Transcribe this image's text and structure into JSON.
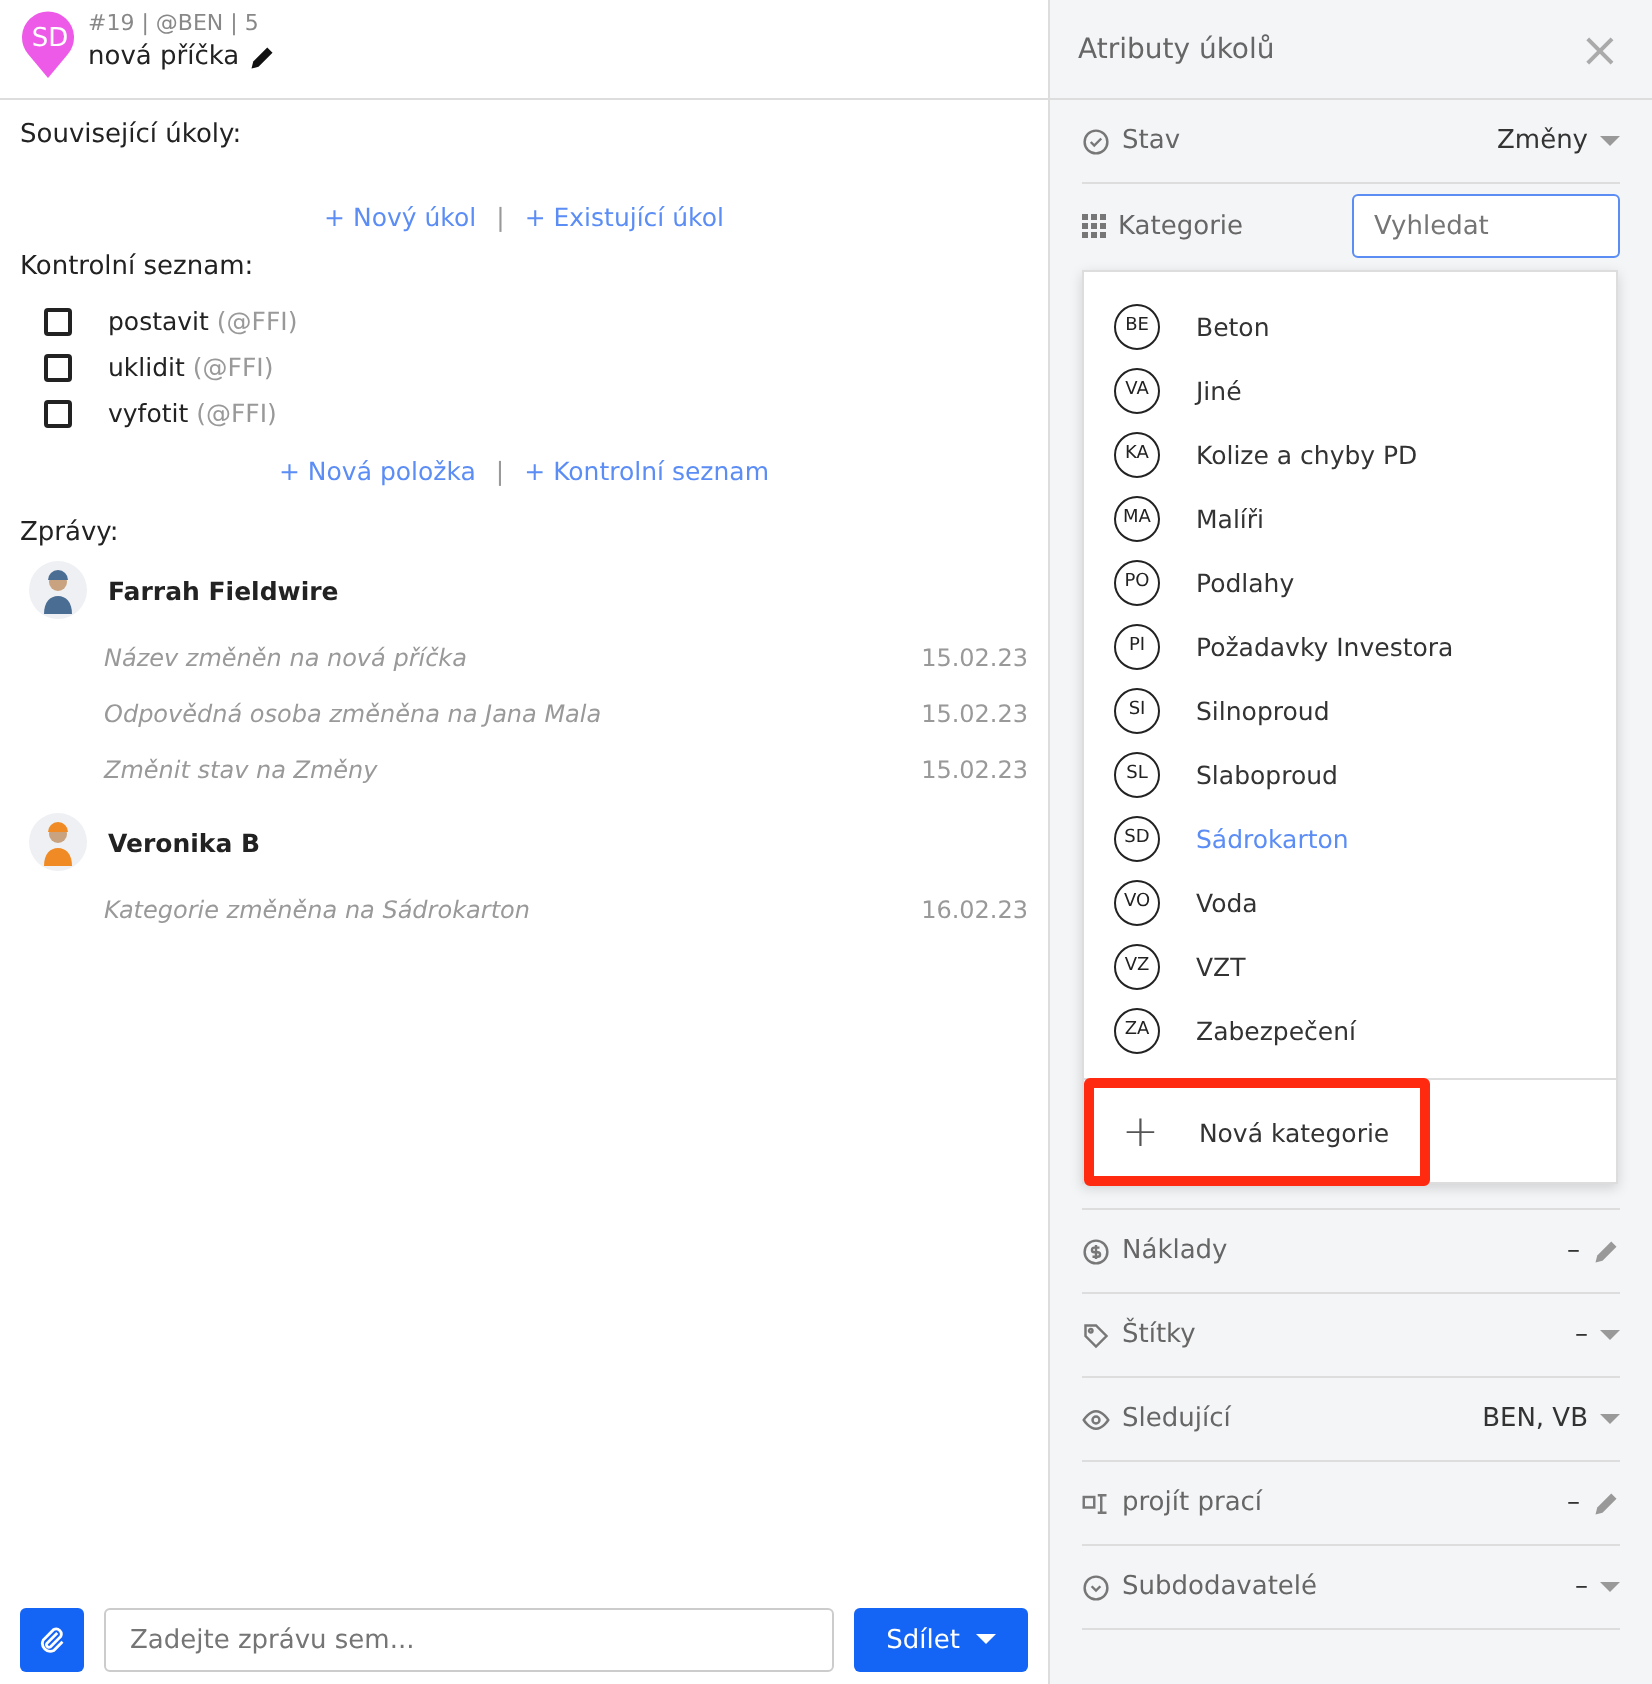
{
  "task": {
    "avatar": "SD",
    "meta": "#19 | @BEN | 5",
    "title": "nová příčka"
  },
  "related": {
    "heading": "Související úkoly:",
    "links": [
      "+ Nový úkol",
      "+ Existující úkol"
    ],
    "separator": "|"
  },
  "checklist": {
    "heading": "Kontrolní seznam:",
    "items": [
      {
        "label": "postavit",
        "assignee": "(@FFI)",
        "checked": false
      },
      {
        "label": "uklidit",
        "assignee": "(@FFI)",
        "checked": false
      },
      {
        "label": "vyfotit",
        "assignee": "(@FFI)",
        "checked": false
      }
    ],
    "links": [
      "+ Nová položka",
      "+ Kontrolní seznam"
    ],
    "separator": "|"
  },
  "messages": {
    "heading": "Zprávy:",
    "groups": [
      {
        "author": "Farrah Fieldwire",
        "entries": [
          {
            "text": "Název změněn na nová příčka",
            "date": "15.02.23"
          },
          {
            "text": "Odpovědná osoba změněna na Jana Mala",
            "date": "15.02.23"
          },
          {
            "text": "Změnit stav na Změny",
            "date": "15.02.23"
          }
        ]
      },
      {
        "author": "Veronika B",
        "entries": [
          {
            "text": "Kategorie změněna na Sádrokarton",
            "date": "16.02.23"
          }
        ]
      }
    ]
  },
  "composer": {
    "placeholder": "Zadejte zprávu sem...",
    "send": "Sdílet"
  },
  "panel": {
    "title": "Atributy úkolů",
    "close": "×",
    "top_rows": [
      {
        "label": "Stav",
        "value": "Změny",
        "kind": "dropdown"
      }
    ],
    "category": {
      "label": "Kategorie",
      "placeholder": "Vyhledat"
    },
    "rows": [
      {
        "label": "Náklady",
        "value": "–",
        "kind": "edit"
      },
      {
        "label": "Štítky",
        "value": "–",
        "kind": "dropdown"
      },
      {
        "label": "Sledující",
        "value": "BEN, VB",
        "kind": "dropdown"
      },
      {
        "label": "projít prací",
        "value": "–",
        "kind": "edit"
      },
      {
        "label": "Subdodavatelé",
        "value": "–",
        "kind": "dropdown"
      }
    ]
  },
  "category_menu": {
    "items": [
      {
        "code": "BE",
        "name": "Beton",
        "selected": false
      },
      {
        "code": "VA",
        "name": "Jiné",
        "selected": false
      },
      {
        "code": "KA",
        "name": "Kolize a chyby PD",
        "selected": false
      },
      {
        "code": "MA",
        "name": "Malíři",
        "selected": false
      },
      {
        "code": "PO",
        "name": "Podlahy",
        "selected": false
      },
      {
        "code": "PI",
        "name": "Požadavky Investora",
        "selected": false
      },
      {
        "code": "SI",
        "name": "Silnoproud",
        "selected": false
      },
      {
        "code": "SL",
        "name": "Slaboproud",
        "selected": false
      },
      {
        "code": "SD",
        "name": "Sádrokarton",
        "selected": true
      },
      {
        "code": "VO",
        "name": "Voda",
        "selected": false
      },
      {
        "code": "VZ",
        "name": "VZT",
        "selected": false
      },
      {
        "code": "ZA",
        "name": "Zabezpečení",
        "selected": false
      }
    ],
    "add": "Nová kategorie",
    "add_plus": "+"
  }
}
